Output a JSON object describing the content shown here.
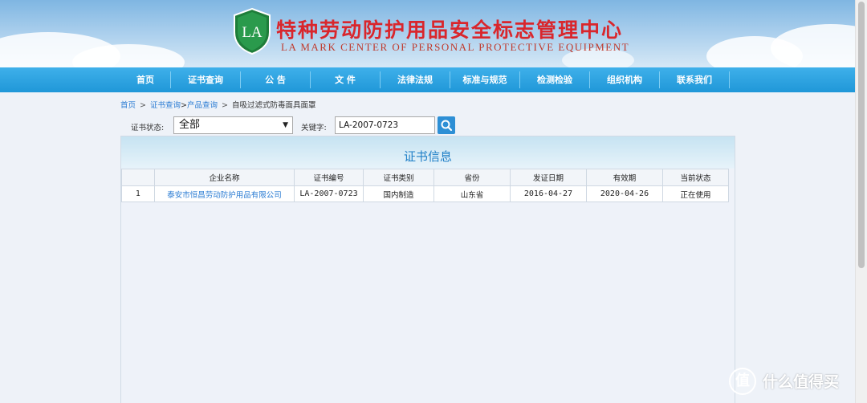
{
  "header": {
    "logo_text": "LA",
    "title": "特种劳动防护用品安全标志管理中心",
    "subtitle": "LA MARK CENTER OF PERSONAL PROTECTIVE EQUIPMENT"
  },
  "nav": {
    "items": [
      "首页",
      "证书查询",
      "公 告",
      "文 件",
      "法律法规",
      "标准与规范",
      "检测检验",
      "组织机构",
      "联系我们"
    ]
  },
  "breadcrumb": {
    "home": "首页",
    "cert_query": "证书查询",
    "product_query": "产品查询",
    "current": "自吸过滤式防毒面具面罩",
    "separator": ">"
  },
  "filter": {
    "status_label": "证书状态:",
    "status_value": "全部",
    "keyword_label": "关键字:",
    "keyword_value": "LA-2007-0723"
  },
  "panel": {
    "title": "证书信息",
    "columns": [
      "",
      "企业名称",
      "证书编号",
      "证书类别",
      "省份",
      "发证日期",
      "有效期",
      "当前状态"
    ],
    "rows": [
      {
        "index": "1",
        "company": "泰安市恒昌劳动防护用品有限公司",
        "cert_no": "LA-2007-0723",
        "category": "国内制造",
        "province": "山东省",
        "issue_date": "2016-04-27",
        "valid_until": "2020-04-26",
        "status": "正在使用"
      }
    ]
  },
  "watermark": {
    "badge": "值",
    "text": "什么值得买"
  },
  "colors": {
    "nav_bg": "#1f97d8",
    "title_red": "#d9262c",
    "link_blue": "#2b7cd3",
    "panel_title": "#1f7fc7",
    "logo_green": "#1e7d3a"
  }
}
